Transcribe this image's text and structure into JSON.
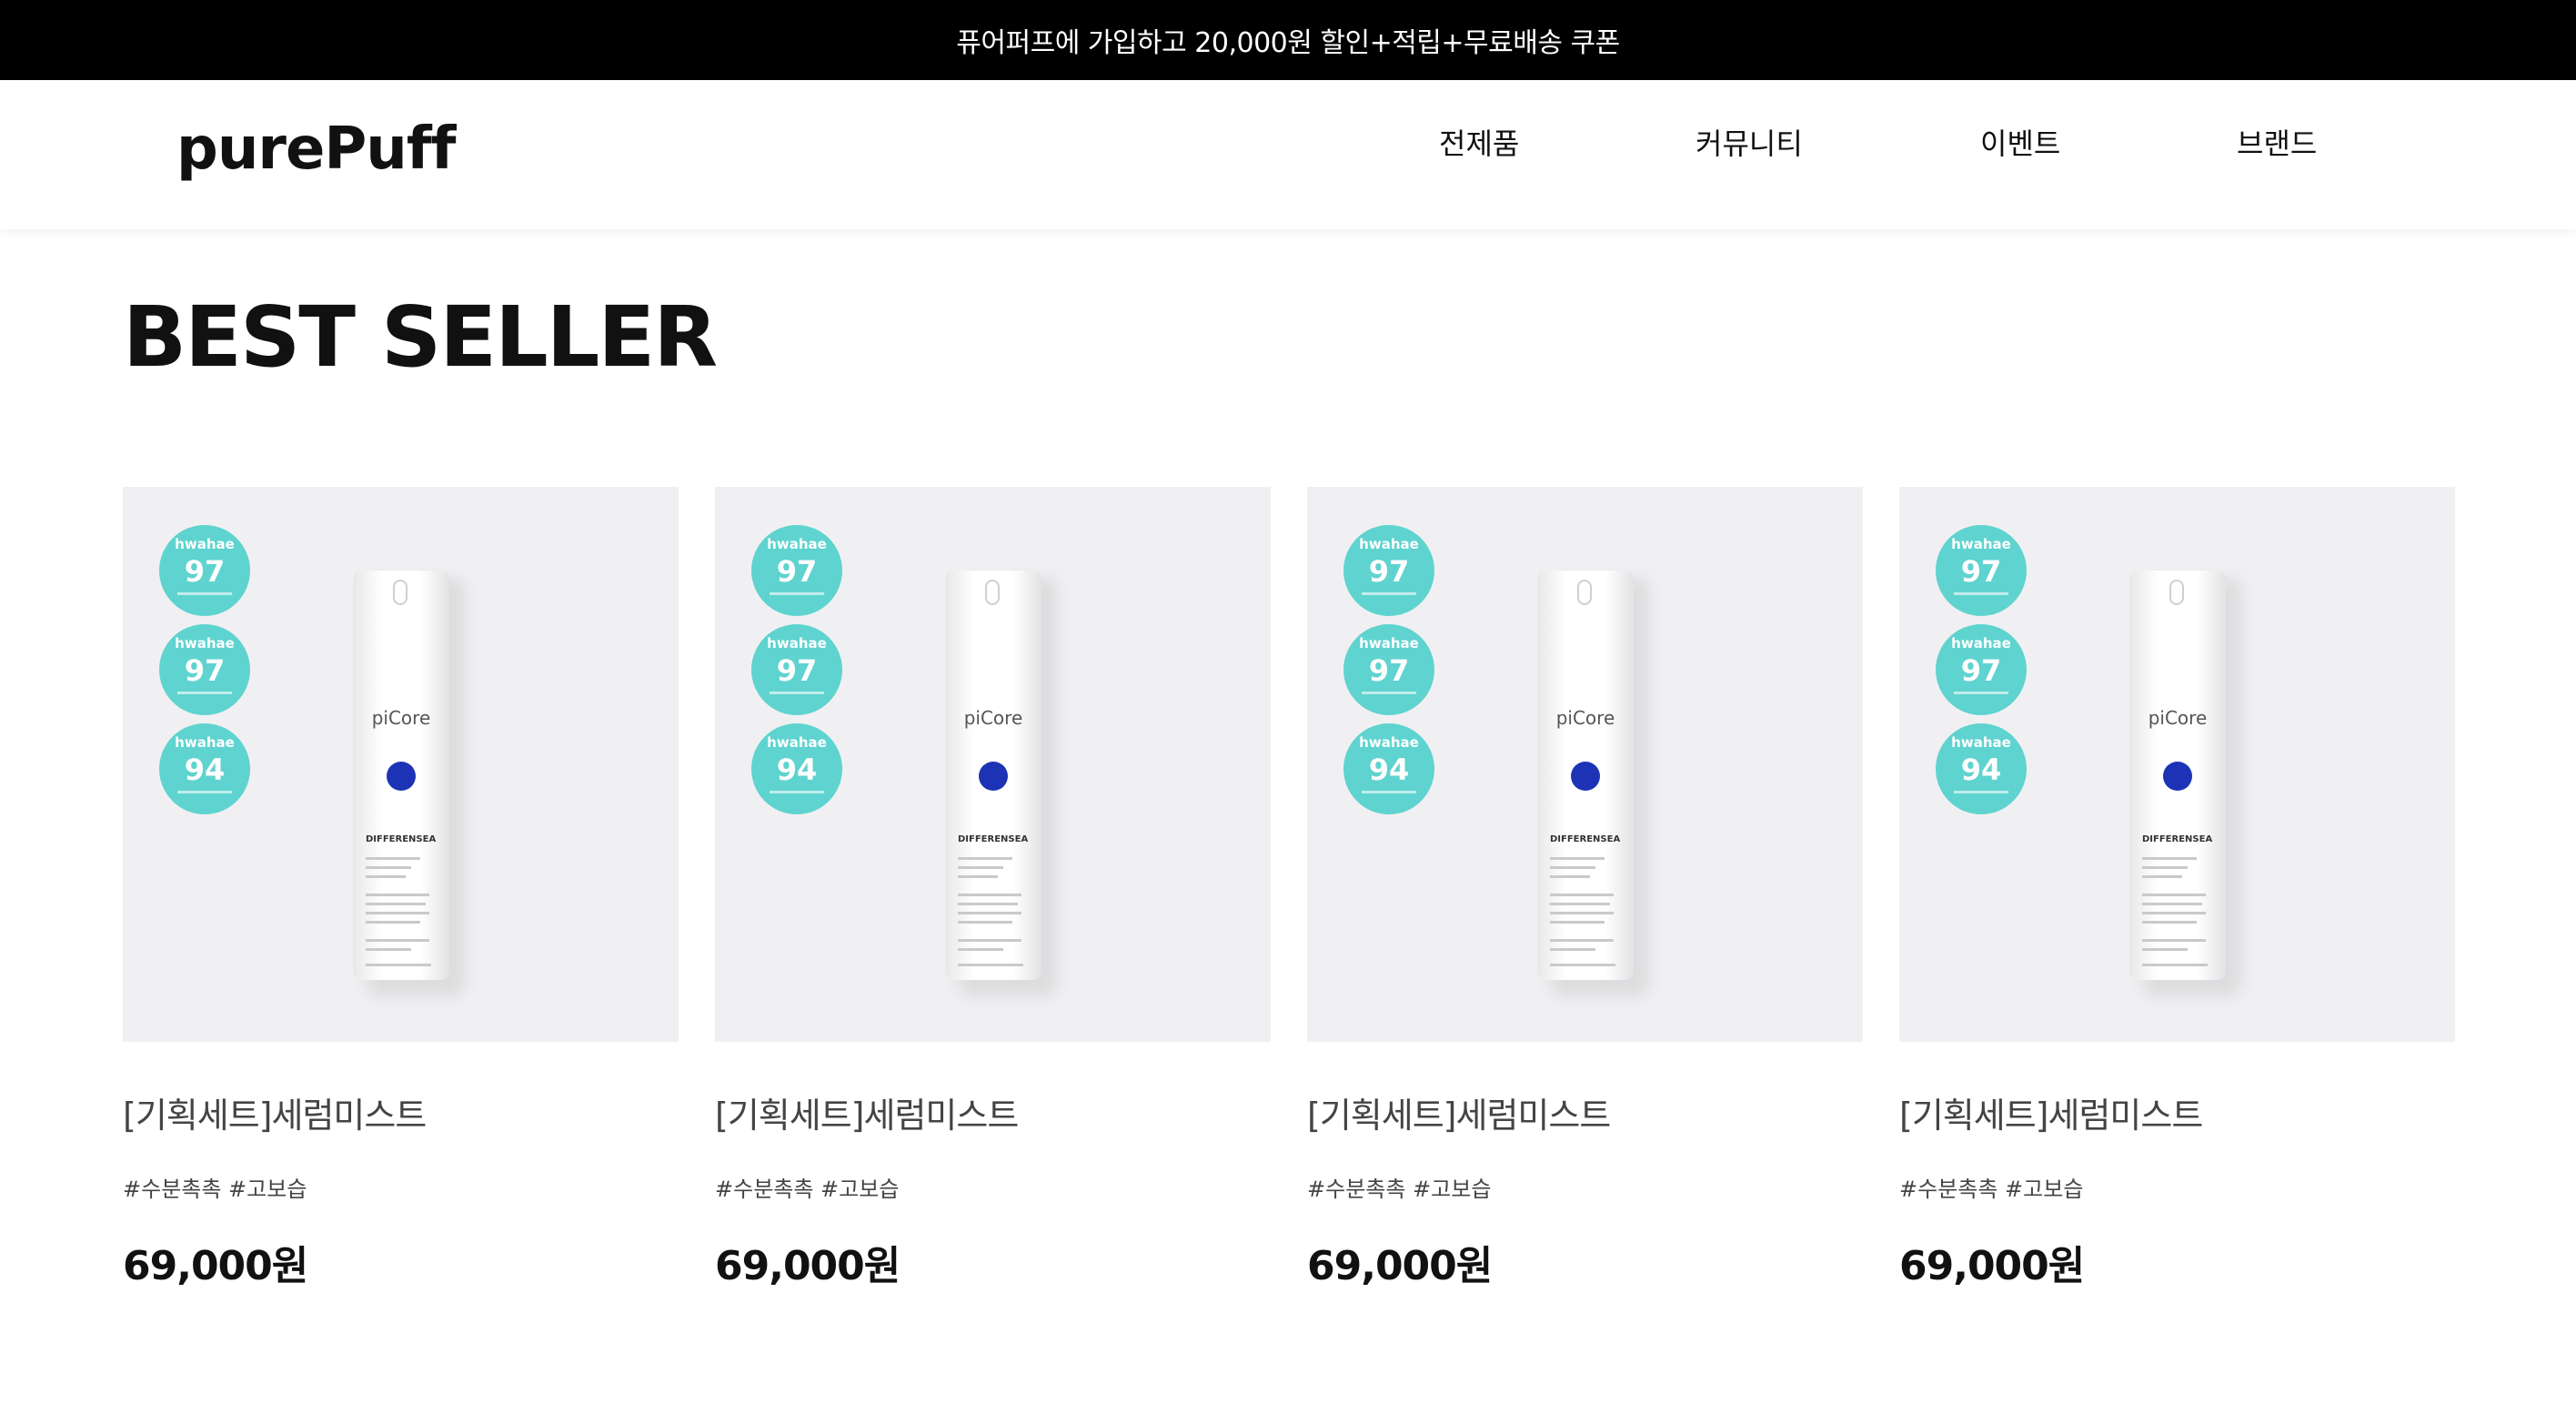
{
  "promo_bar": {
    "text": "퓨어퍼프에 가입하고 20,000원 할인+적립+무료배송 쿠폰"
  },
  "header": {
    "logo": "purePuff",
    "nav": [
      {
        "label": "전제품"
      },
      {
        "label": "커뮤니티"
      },
      {
        "label": "이벤트"
      },
      {
        "label": "브랜드"
      }
    ]
  },
  "section": {
    "title": "BEST SELLER"
  },
  "products": [
    {
      "name": "[기획세트]세럼미스트",
      "tags": "#수분촉촉 #고보습",
      "price": "69,000원",
      "bottle_brand": "piCore",
      "bottle_label": "DIFFERENSEA",
      "badges": [
        {
          "label": "hwahae",
          "score": "97"
        },
        {
          "label": "hwahae",
          "score": "97"
        },
        {
          "label": "hwahae",
          "score": "94"
        }
      ]
    },
    {
      "name": "[기획세트]세럼미스트",
      "tags": "#수분촉촉 #고보습",
      "price": "69,000원",
      "bottle_brand": "piCore",
      "bottle_label": "DIFFERENSEA",
      "badges": [
        {
          "label": "hwahae",
          "score": "97"
        },
        {
          "label": "hwahae",
          "score": "97"
        },
        {
          "label": "hwahae",
          "score": "94"
        }
      ]
    },
    {
      "name": "[기획세트]세럼미스트",
      "tags": "#수분촉촉 #고보습",
      "price": "69,000원",
      "bottle_brand": "piCore",
      "bottle_label": "DIFFERENSEA",
      "badges": [
        {
          "label": "hwahae",
          "score": "97"
        },
        {
          "label": "hwahae",
          "score": "97"
        },
        {
          "label": "hwahae",
          "score": "94"
        }
      ]
    },
    {
      "name": "[기획세트]세럼미스트",
      "tags": "#수분촉촉 #고보습",
      "price": "69,000원",
      "bottle_brand": "piCore",
      "bottle_label": "DIFFERENSEA",
      "badges": [
        {
          "label": "hwahae",
          "score": "97"
        },
        {
          "label": "hwahae",
          "score": "97"
        },
        {
          "label": "hwahae",
          "score": "94"
        }
      ]
    }
  ],
  "colors": {
    "promo_bg": "#000000",
    "badge": "#5fd3cf",
    "bottle_accent": "#1d33b6",
    "thumb_bg": "#f0f0f2"
  }
}
